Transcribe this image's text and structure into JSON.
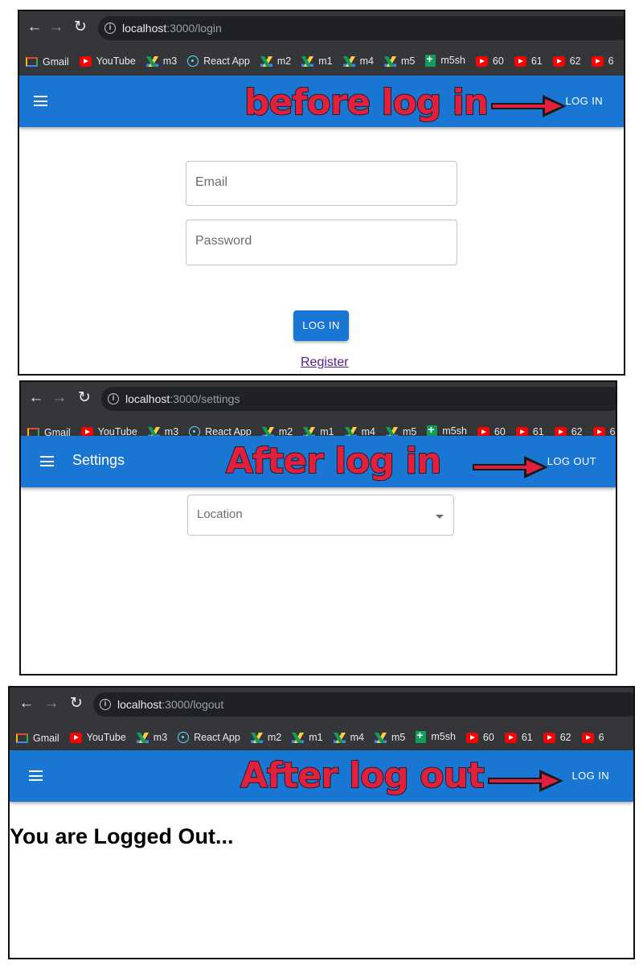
{
  "browser": {
    "back_icon": "arrow-left-icon",
    "forward_icon": "arrow-right-icon",
    "reload_icon": "reload-icon",
    "bookmarks": [
      {
        "label": "Gmail",
        "icon": "gmail"
      },
      {
        "label": "YouTube",
        "icon": "yt"
      },
      {
        "label": "m3",
        "icon": "drive"
      },
      {
        "label": "React App",
        "icon": "react"
      },
      {
        "label": "m2",
        "icon": "drive"
      },
      {
        "label": "m1",
        "icon": "drive"
      },
      {
        "label": "m4",
        "icon": "drive"
      },
      {
        "label": "m5",
        "icon": "drive"
      },
      {
        "label": "m5sh",
        "icon": "sheets"
      },
      {
        "label": "60",
        "icon": "yt"
      },
      {
        "label": "61",
        "icon": "yt"
      },
      {
        "label": "62",
        "icon": "yt"
      },
      {
        "label": "6",
        "icon": "yt"
      }
    ]
  },
  "panels": {
    "login": {
      "url_host": "localhost",
      "url_path": ":3000/login",
      "appbar_title": "",
      "appbar_button": "LOG IN",
      "annotation": "before log in",
      "email_placeholder": "Email",
      "password_placeholder": "Password",
      "login_button": "LOG IN",
      "register_link": "Register"
    },
    "settings": {
      "url_host": "localhost",
      "url_path": ":3000/settings",
      "appbar_title": "Settings",
      "appbar_button": "LOG OUT",
      "annotation": "After log in",
      "location_placeholder": "Location"
    },
    "logout": {
      "url_host": "localhost",
      "url_path": ":3000/logout",
      "appbar_title": "",
      "appbar_button": "LOG IN",
      "annotation": "After log out",
      "message": "You are Logged Out..."
    }
  },
  "colors": {
    "appbar": "#1976d2",
    "annotation_fill": "#e0203c",
    "annotation_outline": "#1a1a1a",
    "browser_chrome": "#35363a"
  }
}
